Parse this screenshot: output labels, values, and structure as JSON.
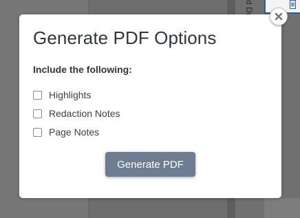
{
  "background": {
    "document_tab_text": "d Do",
    "document_icon": "document-icon"
  },
  "modal": {
    "title": "Generate PDF Options",
    "section_label": "Include the following:",
    "options": [
      {
        "label": "Highlights",
        "checked": false
      },
      {
        "label": "Redaction Notes",
        "checked": false
      },
      {
        "label": "Page Notes",
        "checked": false
      }
    ],
    "generate_label": "Generate PDF",
    "close_icon": "close-icon"
  },
  "colors": {
    "button": "#6f7d92",
    "title_text": "#2f3640",
    "accent_blue": "#2c5c9b"
  }
}
